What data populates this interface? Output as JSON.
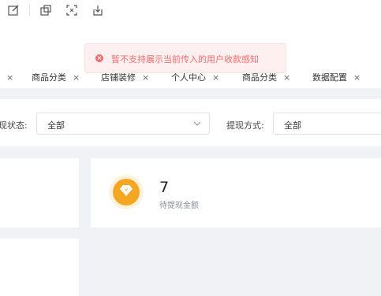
{
  "toolbar": {
    "icons": [
      "edit-icon",
      "copy-window-icon",
      "fullscreen-icon",
      "download-icon"
    ]
  },
  "toast": {
    "message": "暂不支持展示当前传入的用户收款感知",
    "icon": "error-circle-icon",
    "color": "#f56c6c"
  },
  "tabs": {
    "items": [
      {
        "label": "商品分类"
      },
      {
        "label": "店铺装修"
      },
      {
        "label": "个人中心"
      },
      {
        "label": "商品分类"
      },
      {
        "label": "数据配置"
      }
    ],
    "close_glyph": "×"
  },
  "filters": {
    "status_label": "现状态:",
    "status_value": "全部",
    "method_label": "提现方式:",
    "method_value": "全部"
  },
  "stats": {
    "withdraw_pending": {
      "value": "7",
      "label": "待提现金额",
      "icon": "yuan-coin-icon",
      "icon_color": "#f5a623"
    }
  }
}
